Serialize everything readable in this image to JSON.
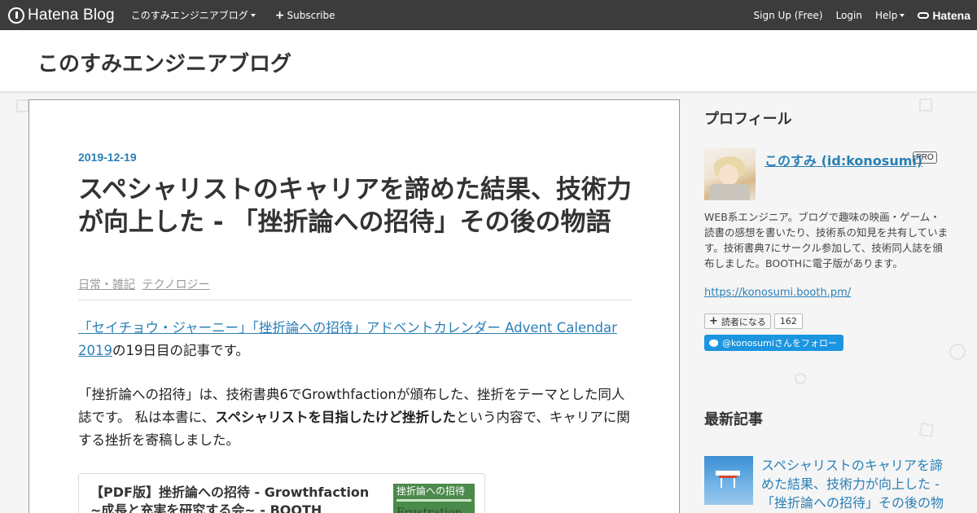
{
  "topbar": {
    "brand": "Hatena Blog",
    "blog_menu": "このすみエンジニアブログ",
    "subscribe": "Subscribe",
    "signup": "Sign Up (Free)",
    "login": "Login",
    "help": "Help",
    "hatena": "Hatena"
  },
  "header": {
    "blog_title": "このすみエンジニアブログ"
  },
  "entry": {
    "date": "2019-12-19",
    "title": "スペシャリストのキャリアを諦めた結果、技術力が向上した - 「挫折論への招待」その後の物語",
    "categories": [
      "日常・雑記",
      "テクノロジー"
    ],
    "p1_link": "「セイチョウ・ジャーニー」「挫折論への招待」アドベントカレンダー Advent Calendar 2019",
    "p1_rest": "の19日目の記事です。",
    "p2_a": "「挫折論への招待」は、技術書典6でGrowthfactionが頒布した、挫折をテーマとした同人誌です。 私は本書に、",
    "p2_bold": "スペシャリストを目指したけど挫折した",
    "p2_b": "という内容で、キャリアに関する挫折を寄稿しました。",
    "embed": {
      "title": "【PDF版】挫折論への招待 - Growthfaction ~成長と充実を研究する会~ - BOOTH",
      "thumb_title": "挫折論への招待",
      "thumb_subtitle": "Frustration"
    }
  },
  "sidebar": {
    "profile_heading": "プロフィール",
    "profile_name": "このすみ (id:konosumi)",
    "pro_badge": "PRO",
    "description": "WEB系エンジニア。ブログで趣味の映画・ゲーム・読書の感想を書いたり、技術系の知見を共有しています。技術書典7にサークル参加して、技術同人誌を頒布しました。BOOTHに電子版があります。",
    "url": "https://konosumi.booth.pm/",
    "reader_button": "読者になる",
    "reader_count": "162",
    "twitter_follow": "@konosumiさんをフォロー",
    "recent_heading": "最新記事",
    "recent_title": "スペシャリストのキャリアを諦めた結果、技術力が向上した - 「挫折論への招待」その後の物語"
  },
  "colors": {
    "topbar": "#3c3c3c",
    "link": "#2a7fb6",
    "twitter": "#1b95e0"
  }
}
